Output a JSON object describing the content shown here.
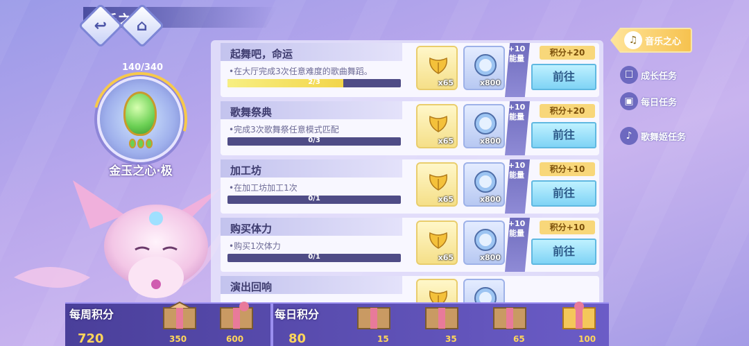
{
  "header": {
    "title": "音乐之心",
    "back_icon": "back-arrow-icon",
    "home_icon": "home-icon"
  },
  "item": {
    "progress": "140/340",
    "progress_ratio": 0.41,
    "name": "金玉之心·极"
  },
  "tasks": [
    {
      "title": "起舞吧，命运",
      "desc": "•在大厅完成3次任意难度的歌曲舞蹈。",
      "progress_label": "2/3",
      "progress": 0.667,
      "reward1_count": "x65",
      "reward2_count": "x800",
      "energy": "+10 能量",
      "points": "积分+20",
      "button": "前往"
    },
    {
      "title": "歌舞祭典",
      "desc": "•完成3次歌舞祭任意模式匹配",
      "progress_label": "0/3",
      "progress": 0,
      "reward1_count": "x65",
      "reward2_count": "x800",
      "energy": "+10 能量",
      "points": "积分+20",
      "button": "前往"
    },
    {
      "title": "加工坊",
      "desc": "•在加工坊加工1次",
      "progress_label": "0/1",
      "progress": 0,
      "reward1_count": "x65",
      "reward2_count": "x800",
      "energy": "+10 能量",
      "points": "积分+10",
      "button": "前往"
    },
    {
      "title": "购买体力",
      "desc": "•购买1次体力",
      "progress_label": "0/1",
      "progress": 0,
      "reward1_count": "x65",
      "reward2_count": "x800",
      "energy": "+10 能量",
      "points": "积分+10",
      "button": "前往"
    },
    {
      "title": "演出回响",
      "desc": "",
      "progress_label": "",
      "progress": 0,
      "reward1_count": "",
      "reward2_count": "",
      "energy": "",
      "points": "",
      "button": ""
    }
  ],
  "side_tabs": [
    {
      "label": "音乐之心",
      "icon": "music-heart-icon",
      "active": true
    },
    {
      "label": "成长任务",
      "icon": "growth-icon",
      "active": false
    },
    {
      "label": "每日任务",
      "icon": "daily-icon",
      "active": false
    },
    {
      "label": "歌舞姬任务",
      "icon": "dancer-icon",
      "active": false
    }
  ],
  "weekly": {
    "label": "每周积分",
    "value": "720",
    "milestones": [
      "350",
      "600"
    ]
  },
  "daily": {
    "label": "每日积分",
    "value": "80",
    "milestones": [
      "15",
      "35",
      "65",
      "100"
    ]
  },
  "colors": {
    "accent": "#f6c24f",
    "button": "#7fd3f5",
    "panel": "#e6e4fc"
  }
}
